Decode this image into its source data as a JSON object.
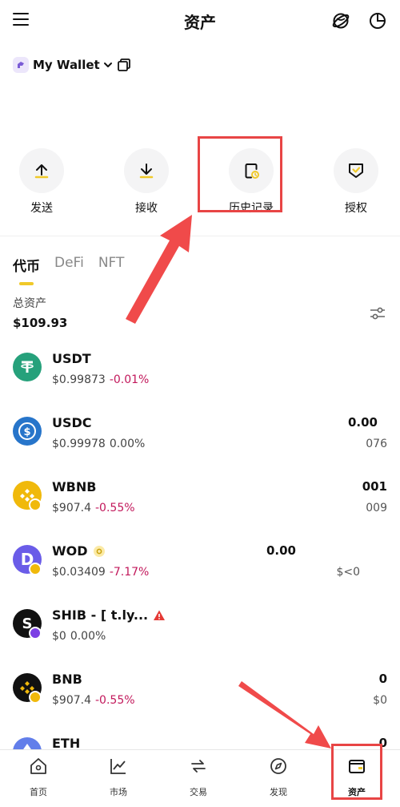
{
  "header": {
    "title": "资产"
  },
  "wallet": {
    "name": "My Wallet"
  },
  "actions": [
    {
      "label": "发送"
    },
    {
      "label": "接收"
    },
    {
      "label": "历史记录"
    },
    {
      "label": "授权"
    }
  ],
  "tabs": [
    {
      "label": "代币",
      "active": true
    },
    {
      "label": "DeFi",
      "active": false
    },
    {
      "label": "NFT",
      "active": false
    }
  ],
  "total": {
    "label": "总资产",
    "value": "$109.93"
  },
  "tokens": [
    {
      "symbol": "USDT",
      "price": "$0.99873",
      "change": "-0.01%",
      "right_value": "",
      "right_sub": ""
    },
    {
      "symbol": "USDC",
      "price": "$0.99978",
      "change": "0.00%",
      "right_value": "0.00",
      "right_sub": "076"
    },
    {
      "symbol": "WBNB",
      "price": "$907.4",
      "change": "-0.55%",
      "right_value": "001",
      "right_sub": "009"
    },
    {
      "symbol": "WOD",
      "price": "$0.03409",
      "change": "-7.17%",
      "right_value": "0.00",
      "right_sub": "$<0"
    },
    {
      "symbol": "SHIB - [ t.ly...",
      "price": "$0",
      "change": "0.00%",
      "right_value": "",
      "right_sub": ""
    },
    {
      "symbol": "BNB",
      "price": "$907.4",
      "change": "-0.55%",
      "right_value": "0",
      "right_sub": "$0"
    },
    {
      "symbol": "ETH",
      "price": "",
      "change": "",
      "right_value": "0",
      "right_sub": ""
    }
  ],
  "bottom_nav": [
    {
      "label": "首页",
      "icon": "home-icon"
    },
    {
      "label": "市场",
      "icon": "chart-icon"
    },
    {
      "label": "交易",
      "icon": "swap-icon"
    },
    {
      "label": "发现",
      "icon": "compass-icon"
    },
    {
      "label": "资产",
      "icon": "wallet-icon"
    }
  ],
  "colors": {
    "accent": "#f0c929",
    "negative": "#c2185b",
    "annotation": "#e84545"
  }
}
